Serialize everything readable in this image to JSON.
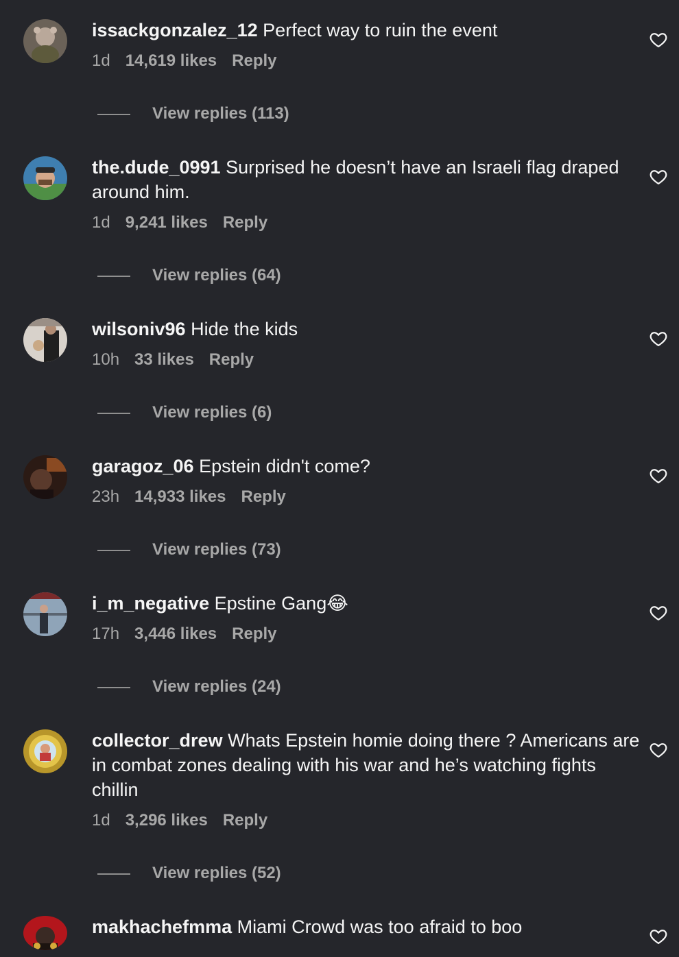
{
  "comments": [
    {
      "username": "issackgonzalez_12",
      "text": "Perfect way to ruin the event",
      "time": "1d",
      "likes": "14,619 likes",
      "reply": "Reply",
      "view_replies": "View replies (113)"
    },
    {
      "username": "the.dude_0991",
      "text": "Surprised he doesn’t have an Israeli flag draped around him.",
      "time": "1d",
      "likes": "9,241 likes",
      "reply": "Reply",
      "view_replies": "View replies (64)"
    },
    {
      "username": "wilsoniv96",
      "text": "Hide the kids",
      "time": "10h",
      "likes": "33 likes",
      "reply": "Reply",
      "view_replies": "View replies (6)"
    },
    {
      "username": "garagoz_06",
      "text": "Epstein didn't come?",
      "time": "23h",
      "likes": "14,933 likes",
      "reply": "Reply",
      "view_replies": "View replies (73)"
    },
    {
      "username": "i_m_negative",
      "text": "Epstine Gang😂",
      "time": "17h",
      "likes": "3,446 likes",
      "reply": "Reply",
      "view_replies": "View replies (24)"
    },
    {
      "username": "collector_drew",
      "text": "Whats Epstein homie doing there ? Americans are in combat zones dealing with his war and he’s watching fights chillin",
      "time": "1d",
      "likes": "3,296 likes",
      "reply": "Reply",
      "view_replies": "View replies (52)"
    },
    {
      "username": "makhachefmma",
      "text": "Miami Crowd was too afraid to boo"
    }
  ],
  "colors": {
    "background": "#25262b",
    "primary_text": "#f5f5f5",
    "secondary_text": "#a8a8a8"
  },
  "icons": {
    "like": "heart-outline-icon"
  }
}
